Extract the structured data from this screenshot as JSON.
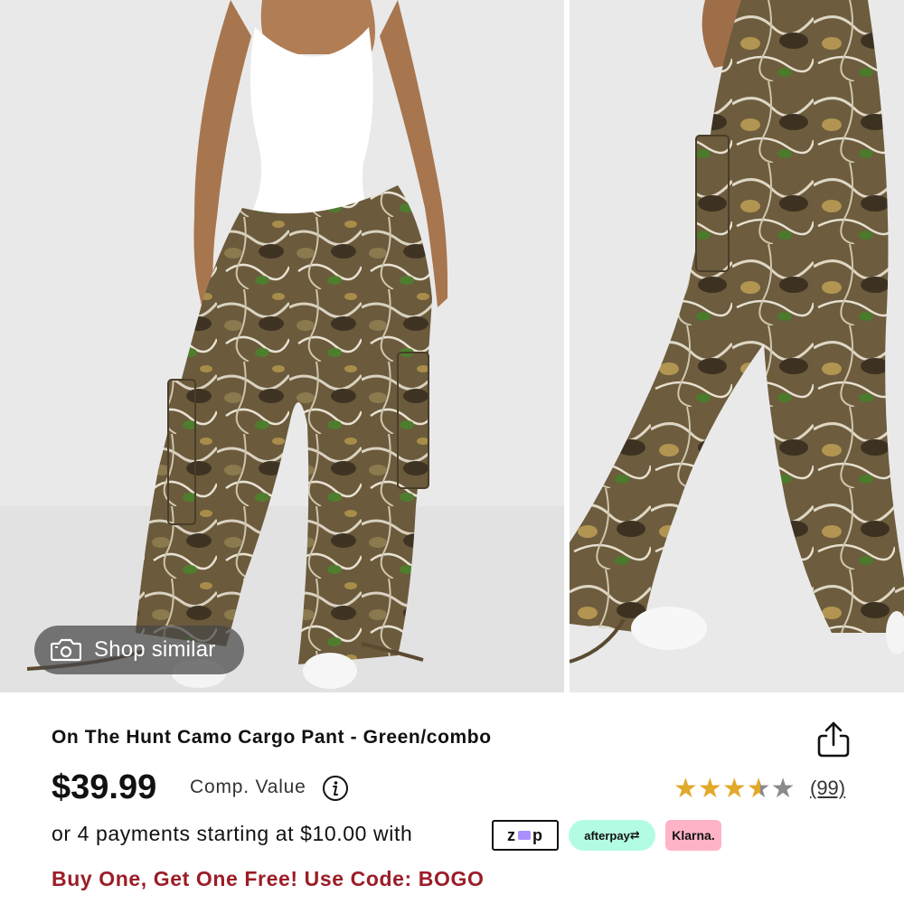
{
  "product": {
    "title": "On The Hunt Camo Cargo Pant - Green/combo",
    "price": "$39.99",
    "comp_value_label": "Comp. Value",
    "rating": 3.5,
    "rating_max": 5,
    "review_count": "(99)",
    "installments_text": "or 4 payments starting at $10.00 with",
    "promo_text": "Buy One, Get One Free! Use Code: BOGO"
  },
  "gallery": {
    "shop_similar_label": "Shop similar"
  },
  "payment_badges": {
    "zip": "zip",
    "afterpay": "afterpay",
    "klarna": "Klarna."
  },
  "colors": {
    "promo": "#9b1d27",
    "star_filled": "#e2a829",
    "star_empty": "#8a8a8a",
    "afterpay_bg": "#b2fce4",
    "klarna_bg": "#ffb3c7",
    "camo_base": "#6b5a3c"
  },
  "icons": {
    "share": "share-icon",
    "camera": "camera-icon",
    "info": "info-icon",
    "star": "star-icon"
  }
}
